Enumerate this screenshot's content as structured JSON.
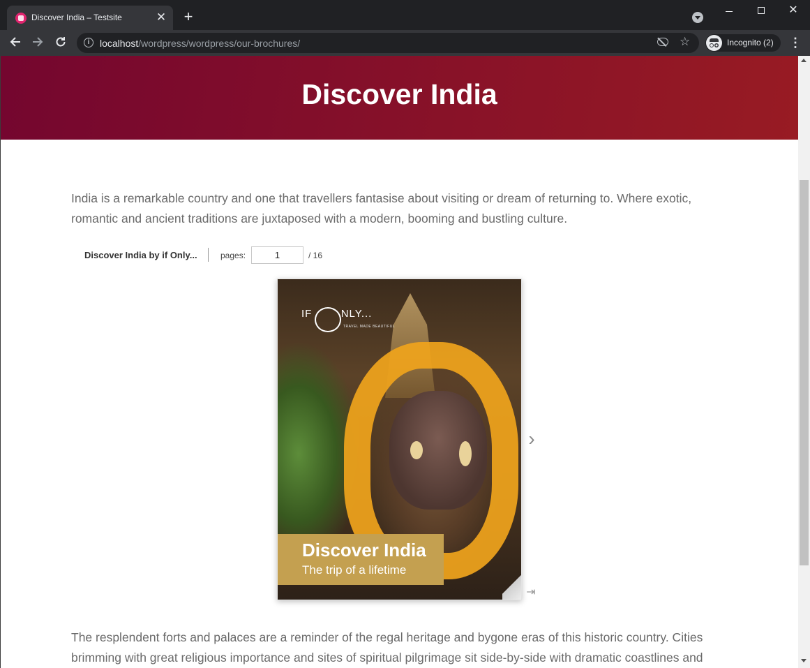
{
  "browser": {
    "tab": {
      "title": "Discover India – Testsite",
      "close_glyph": "✕"
    },
    "new_tab_glyph": "+",
    "address": {
      "host": "localhost",
      "path": "/wordpress/wordpress/our-brochures/"
    },
    "profile": {
      "label": "Incognito (2)"
    },
    "icons": [
      "favicon-icon",
      "tab-search-icon",
      "back-icon",
      "forward-icon",
      "reload-icon",
      "info-icon",
      "eye-off-icon",
      "star-icon",
      "incognito-icon",
      "menu-icon"
    ],
    "window_controls": {
      "close_glyph": "✕"
    }
  },
  "page": {
    "hero_title": "Discover India",
    "intro_paragraph": "India is a remarkable country and one that travellers fantasise about visiting or dream of returning to. Where exotic, romantic and ancient traditions are juxtaposed with a modern, booming and bustling culture.",
    "flipbook": {
      "title": "Discover India by if Only...",
      "pages_label": "pages:",
      "current_page": "1",
      "total_pages": "/ 16",
      "cover": {
        "brand_left": "IF",
        "brand_right": "NLY...",
        "tagline": "TRAVEL MADE BEAUTIFUL",
        "title": "Discover India",
        "subtitle": "The trip of a lifetime",
        "band_color": "#c4a050"
      },
      "next_glyph": "›",
      "last_glyph": "⇥"
    },
    "body_paragraph": "The resplendent forts and palaces are a reminder of the regal heritage and bygone eras of this historic country. Cities brimming with great religious importance and sites of spiritual pilgrimage sit side-by-side with dramatic coastlines and",
    "hero_gradient": [
      "#74062f",
      "#981b23"
    ]
  }
}
